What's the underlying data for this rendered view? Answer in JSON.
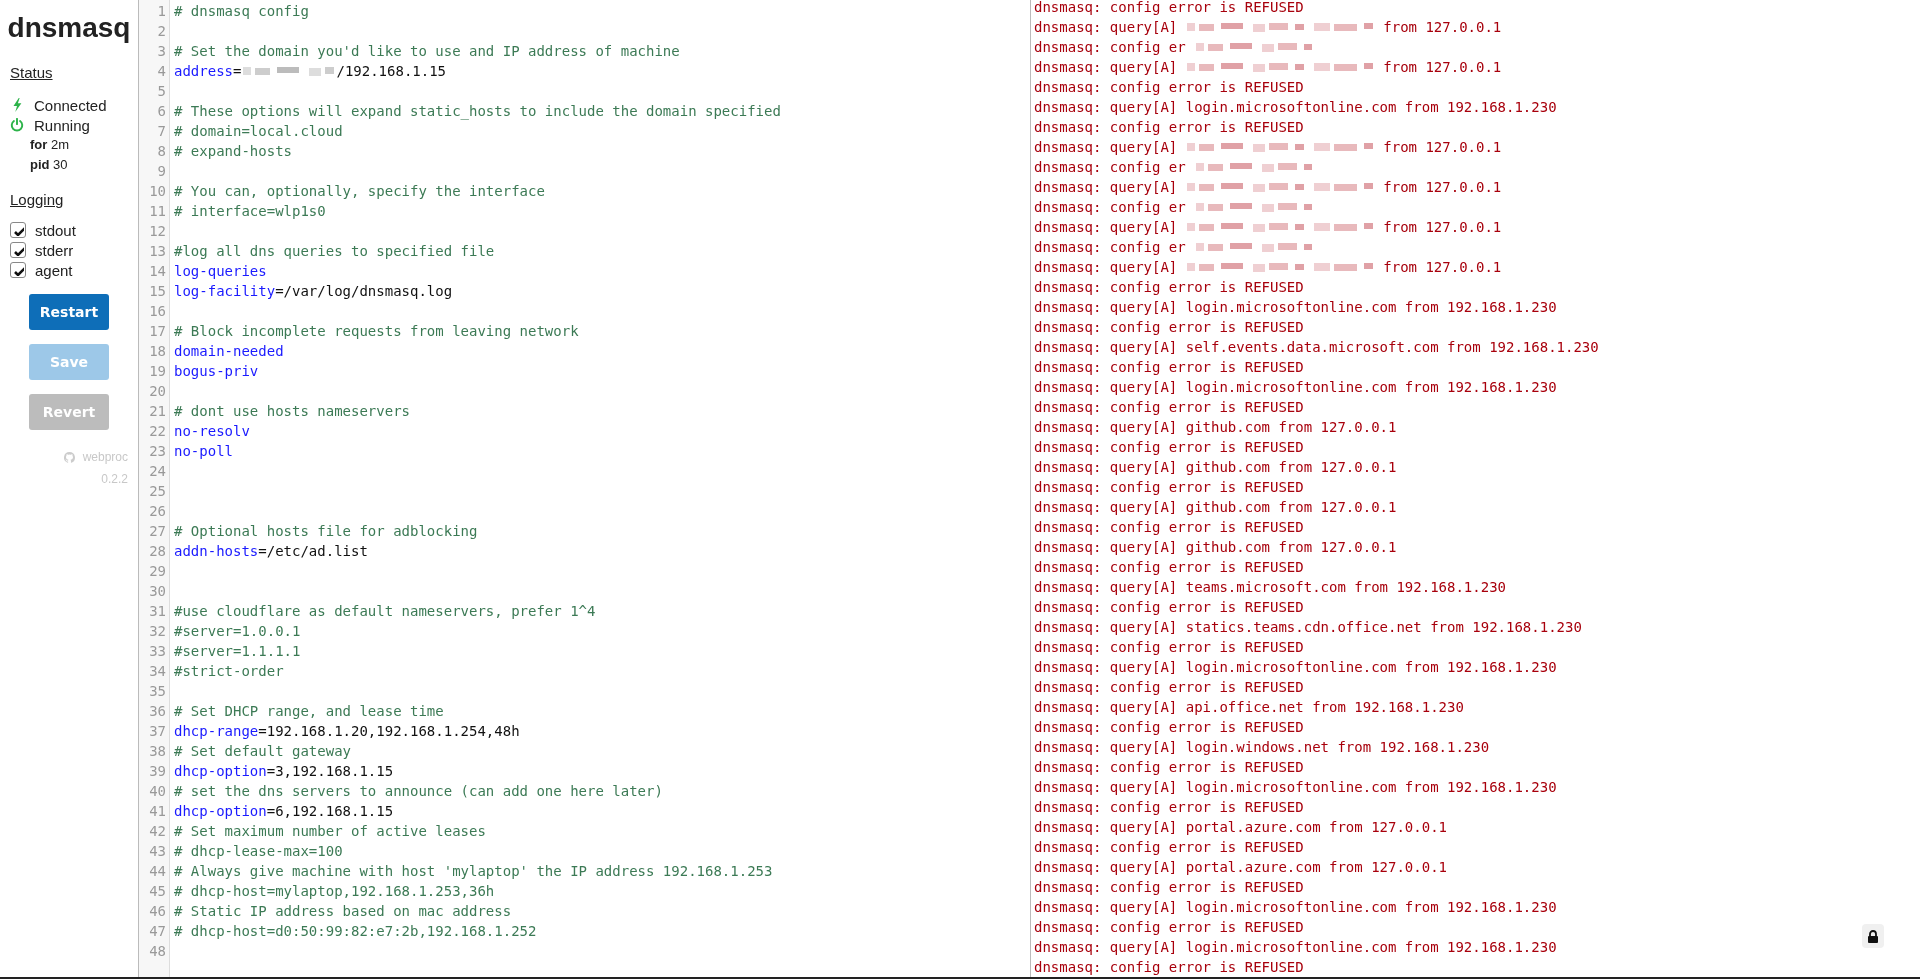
{
  "sidebar": {
    "title": "dnsmasq",
    "status_heading": "Status",
    "status_items": [
      {
        "kind": "bolt",
        "label": "Connected"
      },
      {
        "kind": "power",
        "label": "Running"
      }
    ],
    "details": [
      {
        "label": "for",
        "value": "2m"
      },
      {
        "label": "pid",
        "value": "30"
      }
    ],
    "logging_heading": "Logging",
    "logging": [
      {
        "label": "stdout",
        "checked": true
      },
      {
        "label": "stderr",
        "checked": true
      },
      {
        "label": "agent",
        "checked": true
      }
    ],
    "buttons": [
      {
        "label": "Restart",
        "kind": "primary",
        "disabled": false
      },
      {
        "label": "Save",
        "kind": "primary",
        "disabled": true
      },
      {
        "label": "Revert",
        "kind": "secondary",
        "disabled": true
      }
    ],
    "footer": {
      "link": "webproc",
      "version": "0.2.2"
    }
  },
  "editor": {
    "lines": [
      {
        "number": "1",
        "segments": [
          {
            "kind": "comment",
            "text": "# dnsmasq config"
          }
        ]
      },
      {
        "number": "2"
      },
      {
        "number": "3",
        "segments": [
          {
            "kind": "comment",
            "text": "# Set the domain you'd like to use and IP address of machine"
          }
        ]
      },
      {
        "number": "4",
        "segments": [
          {
            "kind": "key",
            "text": "address"
          },
          {
            "kind": "value",
            "text": "="
          },
          {
            "kind": "redacted"
          },
          {
            "kind": "value",
            "text": "/192.168.1.15"
          }
        ]
      },
      {
        "number": "5"
      },
      {
        "number": "6",
        "segments": [
          {
            "kind": "comment",
            "text": "# These options will expand static_hosts to include the domain specified"
          }
        ]
      },
      {
        "number": "7",
        "segments": [
          {
            "kind": "comment",
            "text": "# domain=local.cloud"
          }
        ]
      },
      {
        "number": "8",
        "segments": [
          {
            "kind": "comment",
            "text": "# expand-hosts"
          }
        ]
      },
      {
        "number": "9"
      },
      {
        "number": "10",
        "segments": [
          {
            "kind": "comment",
            "text": "# You can, optionally, specify the interface"
          }
        ]
      },
      {
        "number": "11",
        "segments": [
          {
            "kind": "comment",
            "text": "# interface=wlp1s0"
          }
        ]
      },
      {
        "number": "12"
      },
      {
        "number": "13",
        "segments": [
          {
            "kind": "comment",
            "text": "#log all dns queries to specified file"
          }
        ]
      },
      {
        "number": "14",
        "segments": [
          {
            "kind": "key",
            "text": "log-queries"
          }
        ]
      },
      {
        "number": "15",
        "segments": [
          {
            "kind": "key",
            "text": "log-facility"
          },
          {
            "kind": "value",
            "text": "=/var/log/dnsmasq.log"
          }
        ]
      },
      {
        "number": "16"
      },
      {
        "number": "17",
        "segments": [
          {
            "kind": "comment",
            "text": "# Block incomplete requests from leaving network"
          }
        ]
      },
      {
        "number": "18",
        "segments": [
          {
            "kind": "key",
            "text": "domain-needed"
          }
        ]
      },
      {
        "number": "19",
        "segments": [
          {
            "kind": "key",
            "text": "bogus-priv"
          }
        ]
      },
      {
        "number": "20"
      },
      {
        "number": "21",
        "segments": [
          {
            "kind": "comment",
            "text": "# dont use hosts nameservers"
          }
        ]
      },
      {
        "number": "22",
        "segments": [
          {
            "kind": "key",
            "text": "no-resolv"
          }
        ]
      },
      {
        "number": "23",
        "segments": [
          {
            "kind": "key",
            "text": "no-poll"
          }
        ]
      },
      {
        "number": "24"
      },
      {
        "number": "25"
      },
      {
        "number": "26"
      },
      {
        "number": "27",
        "segments": [
          {
            "kind": "comment",
            "text": "# Optional hosts file for adblocking"
          }
        ]
      },
      {
        "number": "28",
        "segments": [
          {
            "kind": "key",
            "text": "addn-hosts"
          },
          {
            "kind": "value",
            "text": "=/etc/ad.list"
          }
        ]
      },
      {
        "number": "29"
      },
      {
        "number": "30"
      },
      {
        "number": "31",
        "segments": [
          {
            "kind": "comment",
            "text": "#use cloudflare as default nameservers, prefer 1^4"
          }
        ]
      },
      {
        "number": "32",
        "segments": [
          {
            "kind": "comment",
            "text": "#server=1.0.0.1"
          }
        ]
      },
      {
        "number": "33",
        "segments": [
          {
            "kind": "comment",
            "text": "#server=1.1.1.1"
          }
        ]
      },
      {
        "number": "34",
        "segments": [
          {
            "kind": "comment",
            "text": "#strict-order"
          }
        ]
      },
      {
        "number": "35"
      },
      {
        "number": "36",
        "segments": [
          {
            "kind": "comment",
            "text": "# Set DHCP range, and lease time"
          }
        ]
      },
      {
        "number": "37",
        "segments": [
          {
            "kind": "key",
            "text": "dhcp-range"
          },
          {
            "kind": "value",
            "text": "=192.168.1.20,192.168.1.254,48h"
          }
        ]
      },
      {
        "number": "38",
        "segments": [
          {
            "kind": "comment",
            "text": "# Set default gateway"
          }
        ]
      },
      {
        "number": "39",
        "segments": [
          {
            "kind": "key",
            "text": "dhcp-option"
          },
          {
            "kind": "value",
            "text": "=3,192.168.1.15"
          }
        ]
      },
      {
        "number": "40",
        "segments": [
          {
            "kind": "comment",
            "text": "# set the dns servers to announce (can add one here later)"
          }
        ]
      },
      {
        "number": "41",
        "segments": [
          {
            "kind": "key",
            "text": "dhcp-option"
          },
          {
            "kind": "value",
            "text": "=6,192.168.1.15"
          }
        ]
      },
      {
        "number": "42",
        "segments": [
          {
            "kind": "comment",
            "text": "# Set maximum number of active leases"
          }
        ]
      },
      {
        "number": "43",
        "segments": [
          {
            "kind": "comment",
            "text": "# dhcp-lease-max=100"
          }
        ]
      },
      {
        "number": "44",
        "segments": [
          {
            "kind": "comment",
            "text": "# Always give machine with host 'mylaptop' the IP address 192.168.1.253"
          }
        ]
      },
      {
        "number": "45",
        "segments": [
          {
            "kind": "comment",
            "text": "# dhcp-host=mylaptop,192.168.1.253,36h"
          }
        ]
      },
      {
        "number": "46",
        "segments": [
          {
            "kind": "comment",
            "text": "# Static IP address based on mac address"
          }
        ]
      },
      {
        "number": "47",
        "segments": [
          {
            "kind": "comment",
            "text": "# dhcp-host=d0:50:99:82:e7:2b,192.168.1.252"
          }
        ]
      },
      {
        "number": "48"
      }
    ]
  },
  "log": {
    "lines": [
      {
        "segments": [
          {
            "kind": "text",
            "text": "dnsmasq: config error is REFUSED"
          }
        ]
      },
      {
        "segments": [
          {
            "kind": "text",
            "text": "dnsmasq: query[A]"
          },
          {
            "kind": "redacted"
          },
          {
            "kind": "text",
            "text": "from 127.0.0.1"
          }
        ]
      },
      {
        "segments": [
          {
            "kind": "text",
            "text": "dnsmasq: config er"
          },
          {
            "kind": "redacted"
          }
        ]
      },
      {
        "segments": [
          {
            "kind": "text",
            "text": "dnsmasq: query[A]"
          },
          {
            "kind": "redacted"
          },
          {
            "kind": "text",
            "text": "from 127.0.0.1"
          }
        ]
      },
      {
        "segments": [
          {
            "kind": "text",
            "text": "dnsmasq: config error is REFUSED"
          }
        ]
      },
      {
        "segments": [
          {
            "kind": "text",
            "text": "dnsmasq: query[A] login.microsoftonline.com from 192.168.1.230"
          }
        ]
      },
      {
        "segments": [
          {
            "kind": "text",
            "text": "dnsmasq: config error is REFUSED"
          }
        ]
      },
      {
        "segments": [
          {
            "kind": "text",
            "text": "dnsmasq: query[A]"
          },
          {
            "kind": "redacted"
          },
          {
            "kind": "text",
            "text": "from 127.0.0.1"
          }
        ]
      },
      {
        "segments": [
          {
            "kind": "text",
            "text": "dnsmasq: config er"
          },
          {
            "kind": "redacted"
          }
        ]
      },
      {
        "segments": [
          {
            "kind": "text",
            "text": "dnsmasq: query[A]"
          },
          {
            "kind": "redacted"
          },
          {
            "kind": "text",
            "text": "from 127.0.0.1"
          }
        ]
      },
      {
        "segments": [
          {
            "kind": "text",
            "text": "dnsmasq: config er"
          },
          {
            "kind": "redacted"
          }
        ]
      },
      {
        "segments": [
          {
            "kind": "text",
            "text": "dnsmasq: query[A]"
          },
          {
            "kind": "redacted"
          },
          {
            "kind": "text",
            "text": "from 127.0.0.1"
          }
        ]
      },
      {
        "segments": [
          {
            "kind": "text",
            "text": "dnsmasq: config er"
          },
          {
            "kind": "redacted"
          }
        ]
      },
      {
        "segments": [
          {
            "kind": "text",
            "text": "dnsmasq: query[A]"
          },
          {
            "kind": "redacted"
          },
          {
            "kind": "text",
            "text": "from 127.0.0.1"
          }
        ]
      },
      {
        "segments": [
          {
            "kind": "text",
            "text": "dnsmasq: config error is REFUSED"
          }
        ]
      },
      {
        "segments": [
          {
            "kind": "text",
            "text": "dnsmasq: query[A] login.microsoftonline.com from 192.168.1.230"
          }
        ]
      },
      {
        "segments": [
          {
            "kind": "text",
            "text": "dnsmasq: config error is REFUSED"
          }
        ]
      },
      {
        "segments": [
          {
            "kind": "text",
            "text": "dnsmasq: query[A] self.events.data.microsoft.com from 192.168.1.230"
          }
        ]
      },
      {
        "segments": [
          {
            "kind": "text",
            "text": "dnsmasq: config error is REFUSED"
          }
        ]
      },
      {
        "segments": [
          {
            "kind": "text",
            "text": "dnsmasq: query[A] login.microsoftonline.com from 192.168.1.230"
          }
        ]
      },
      {
        "segments": [
          {
            "kind": "text",
            "text": "dnsmasq: config error is REFUSED"
          }
        ]
      },
      {
        "segments": [
          {
            "kind": "text",
            "text": "dnsmasq: query[A] github.com from 127.0.0.1"
          }
        ]
      },
      {
        "segments": [
          {
            "kind": "text",
            "text": "dnsmasq: config error is REFUSED"
          }
        ]
      },
      {
        "segments": [
          {
            "kind": "text",
            "text": "dnsmasq: query[A] github.com from 127.0.0.1"
          }
        ]
      },
      {
        "segments": [
          {
            "kind": "text",
            "text": "dnsmasq: config error is REFUSED"
          }
        ]
      },
      {
        "segments": [
          {
            "kind": "text",
            "text": "dnsmasq: query[A] github.com from 127.0.0.1"
          }
        ]
      },
      {
        "segments": [
          {
            "kind": "text",
            "text": "dnsmasq: config error is REFUSED"
          }
        ]
      },
      {
        "segments": [
          {
            "kind": "text",
            "text": "dnsmasq: query[A] github.com from 127.0.0.1"
          }
        ]
      },
      {
        "segments": [
          {
            "kind": "text",
            "text": "dnsmasq: config error is REFUSED"
          }
        ]
      },
      {
        "segments": [
          {
            "kind": "text",
            "text": "dnsmasq: query[A] teams.microsoft.com from 192.168.1.230"
          }
        ]
      },
      {
        "segments": [
          {
            "kind": "text",
            "text": "dnsmasq: config error is REFUSED"
          }
        ]
      },
      {
        "segments": [
          {
            "kind": "text",
            "text": "dnsmasq: query[A] statics.teams.cdn.office.net from 192.168.1.230"
          }
        ]
      },
      {
        "segments": [
          {
            "kind": "text",
            "text": "dnsmasq: config error is REFUSED"
          }
        ]
      },
      {
        "segments": [
          {
            "kind": "text",
            "text": "dnsmasq: query[A] login.microsoftonline.com from 192.168.1.230"
          }
        ]
      },
      {
        "segments": [
          {
            "kind": "text",
            "text": "dnsmasq: config error is REFUSED"
          }
        ]
      },
      {
        "segments": [
          {
            "kind": "text",
            "text": "dnsmasq: query[A] api.office.net from 192.168.1.230"
          }
        ]
      },
      {
        "segments": [
          {
            "kind": "text",
            "text": "dnsmasq: config error is REFUSED"
          }
        ]
      },
      {
        "segments": [
          {
            "kind": "text",
            "text": "dnsmasq: query[A] login.windows.net from 192.168.1.230"
          }
        ]
      },
      {
        "segments": [
          {
            "kind": "text",
            "text": "dnsmasq: config error is REFUSED"
          }
        ]
      },
      {
        "segments": [
          {
            "kind": "text",
            "text": "dnsmasq: query[A] login.microsoftonline.com from 192.168.1.230"
          }
        ]
      },
      {
        "segments": [
          {
            "kind": "text",
            "text": "dnsmasq: config error is REFUSED"
          }
        ]
      },
      {
        "segments": [
          {
            "kind": "text",
            "text": "dnsmasq: query[A] portal.azure.com from 127.0.0.1"
          }
        ]
      },
      {
        "segments": [
          {
            "kind": "text",
            "text": "dnsmasq: config error is REFUSED"
          }
        ]
      },
      {
        "segments": [
          {
            "kind": "text",
            "text": "dnsmasq: query[A] portal.azure.com from 127.0.0.1"
          }
        ]
      },
      {
        "segments": [
          {
            "kind": "text",
            "text": "dnsmasq: config error is REFUSED"
          }
        ]
      },
      {
        "segments": [
          {
            "kind": "text",
            "text": "dnsmasq: query[A] login.microsoftonline.com from 192.168.1.230"
          }
        ]
      },
      {
        "segments": [
          {
            "kind": "text",
            "text": "dnsmasq: config error is REFUSED"
          }
        ]
      },
      {
        "segments": [
          {
            "kind": "text",
            "text": "dnsmasq: query[A] login.microsoftonline.com from 192.168.1.230"
          }
        ]
      },
      {
        "segments": [
          {
            "kind": "text",
            "text": "dnsmasq: config error is REFUSED"
          }
        ]
      }
    ]
  }
}
